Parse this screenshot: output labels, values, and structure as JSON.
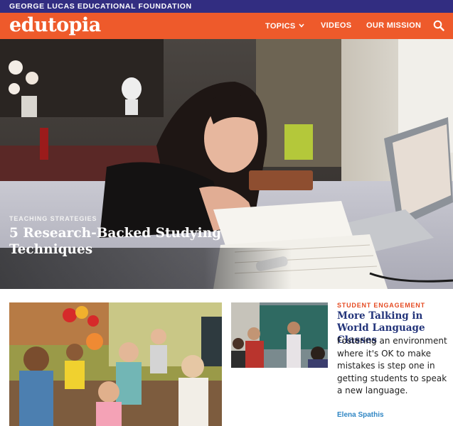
{
  "header": {
    "foundation": "GEORGE LUCAS EDUCATIONAL FOUNDATION",
    "logo": "edutopia",
    "nav": {
      "topics": "TOPICS",
      "videos": "VIDEOS",
      "mission": "OUR MISSION"
    },
    "search_icon": "search-icon",
    "colors": {
      "top_bar": "#322d81",
      "nav_bar": "#ee5a2b"
    }
  },
  "hero": {
    "kicker": "TEACHING STRATEGIES",
    "title": "5 Research-Backed Studying Techniques"
  },
  "featured_cards": {
    "card": {
      "kicker": "STUDENT ENGAGEMENT",
      "title": "More Talking in World Language Classes",
      "summary": "Fostering an environment where it's OK to make mistakes is step one in getting students to speak a new language.",
      "author": "Elena Spathis",
      "colors": {
        "kicker": "#e54b22",
        "title": "#23347a",
        "author": "#2f86c4"
      }
    }
  }
}
